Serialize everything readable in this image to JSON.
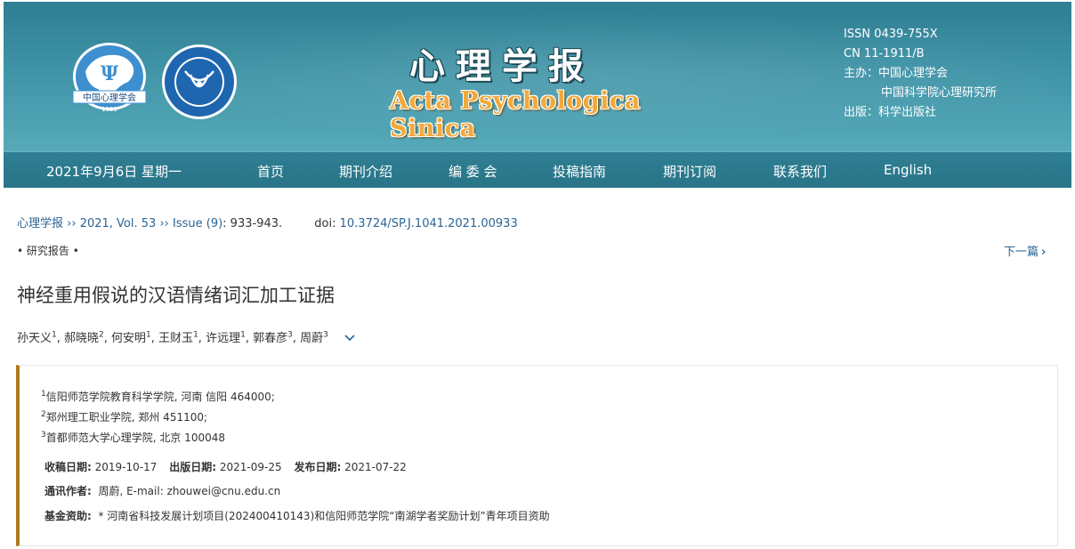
{
  "banner": {
    "title_cn": "心理学报",
    "title_en": "Acta Psychologica Sinica",
    "logo1_text": "中国心理学会",
    "logo1_year": "1921",
    "meta": {
      "issn": "ISSN 0439-755X",
      "cn": "CN 11-1911/B",
      "sponsor_1": "主办：中国心理学会",
      "sponsor_2": "中国科学院心理研究所",
      "publisher": "出版：科学出版社"
    }
  },
  "nav": {
    "date": "2021年9月6日 星期一",
    "items": [
      "首页",
      "期刊介绍",
      "编 委 会",
      "投稿指南",
      "期刊订阅",
      "联系我们",
      "English"
    ]
  },
  "breadcrumb": {
    "journal": "心理学报",
    "sep": "››",
    "volume": "2021, Vol. 53",
    "issue": "Issue (9)",
    "pages": ": 933-943.",
    "doi_label": "doi:",
    "doi": "10.3724/SP.J.1041.2021.00933"
  },
  "article": {
    "section": "• 研究报告 •",
    "next_label": "下一篇",
    "title": "神经重用假说的汉语情绪词汇加工证据",
    "authors": [
      {
        "name": "孙天义",
        "aff": "1"
      },
      {
        "name": "郝晓晓",
        "aff": "2"
      },
      {
        "name": "何安明",
        "aff": "1"
      },
      {
        "name": "王财玉",
        "aff": "1"
      },
      {
        "name": "许远理",
        "aff": "1"
      },
      {
        "name": "郭春彦",
        "aff": "3"
      },
      {
        "name": "周蔚",
        "aff": "3"
      }
    ],
    "affiliations": [
      {
        "num": "1",
        "text": "信阳师范学院教育科学学院, 河南 信阳 464000;"
      },
      {
        "num": "2",
        "text": "郑州理工职业学院, 郑州 451100;"
      },
      {
        "num": "3",
        "text": "首都师范大学心理学院, 北京 100048"
      }
    ],
    "received_label": "收稿日期:",
    "received": "2019-10-17",
    "published_label": "出版日期:",
    "published": "2021-09-25",
    "online_label": "发布日期:",
    "online": "2021-07-22",
    "corr_label": "通讯作者:",
    "corr": "周蔚, E-mail: zhouwei@cnu.edu.cn",
    "fund_label": "基金资助:",
    "fund": "* 河南省科技发展计划项目(202400410143)和信阳师范学院“南湖学者奖励计划”青年项目资助"
  }
}
